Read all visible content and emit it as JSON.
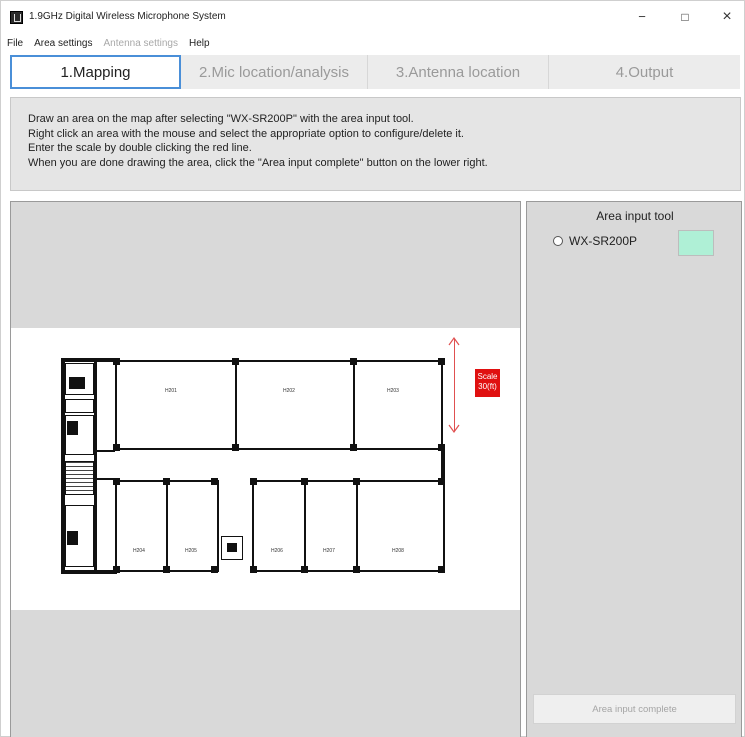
{
  "window": {
    "title": "1.9GHz Digital Wireless Microphone System",
    "controls": {
      "minimize": "−",
      "maximize": "□",
      "close": "×"
    }
  },
  "menu": [
    {
      "label": "File",
      "enabled": true
    },
    {
      "label": "Area settings",
      "enabled": true
    },
    {
      "label": "Antenna settings",
      "enabled": false
    },
    {
      "label": "Help",
      "enabled": true
    }
  ],
  "tabs": [
    {
      "label": "1.Mapping",
      "active": true
    },
    {
      "label": "2.Mic location/analysis",
      "active": false
    },
    {
      "label": "3.Antenna location",
      "active": false
    },
    {
      "label": "4.Output",
      "active": false
    }
  ],
  "instructions": [
    "Draw an area on the map after selecting \"WX-SR200P\" with the area input tool.",
    "Right click an area with the mouse and select the appropriate option to configure/delete it.",
    "Enter the scale by double clicking the red line.",
    "When you are done drawing the area, click the \"Area input complete\" button on the lower right."
  ],
  "map": {
    "rooms": [
      "H201",
      "H202",
      "H203",
      "H204",
      "H205",
      "H206",
      "H207",
      "H208"
    ],
    "scale": {
      "line1": "Scale",
      "line2": "30(ft)"
    }
  },
  "area_tool": {
    "title": "Area input tool",
    "option_label": "WX-SR200P",
    "option_color": "#aff0d6",
    "complete_button": "Area input complete"
  }
}
